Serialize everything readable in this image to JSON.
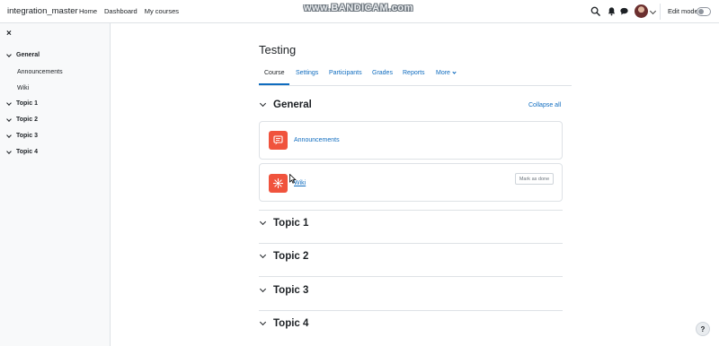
{
  "navbar": {
    "brand": "integration_master",
    "links": [
      "Home",
      "Dashboard",
      "My courses"
    ],
    "watermark": "www.BANDICAM.com",
    "edit_mode_label": "Edit mode",
    "icons": [
      "search-icon",
      "bell-icon",
      "chat-icon",
      "user-avatar"
    ]
  },
  "drawer": {
    "close_label": "×",
    "sections": [
      {
        "label": "General",
        "items": [
          "Announcements",
          "Wiki"
        ]
      },
      {
        "label": "Topic 1"
      },
      {
        "label": "Topic 2"
      },
      {
        "label": "Topic 3"
      },
      {
        "label": "Topic 4"
      }
    ]
  },
  "course": {
    "title": "Testing",
    "tabs": [
      "Course",
      "Settings",
      "Participants",
      "Grades",
      "Reports",
      "More"
    ],
    "active_tab": "Course",
    "collapse_all": "Collapse all",
    "sections": [
      {
        "label": "General"
      },
      {
        "label": "Topic 1"
      },
      {
        "label": "Topic 2"
      },
      {
        "label": "Topic 3"
      },
      {
        "label": "Topic 4"
      }
    ],
    "activities": [
      {
        "name": "Announcements",
        "icon": "forum-icon"
      },
      {
        "name": "Wiki",
        "icon": "wiki-icon",
        "action": "Mark as done"
      }
    ]
  },
  "help_label": "?",
  "colors": {
    "accent": "#0f6cbf",
    "activity_icon": "#f0533d"
  }
}
